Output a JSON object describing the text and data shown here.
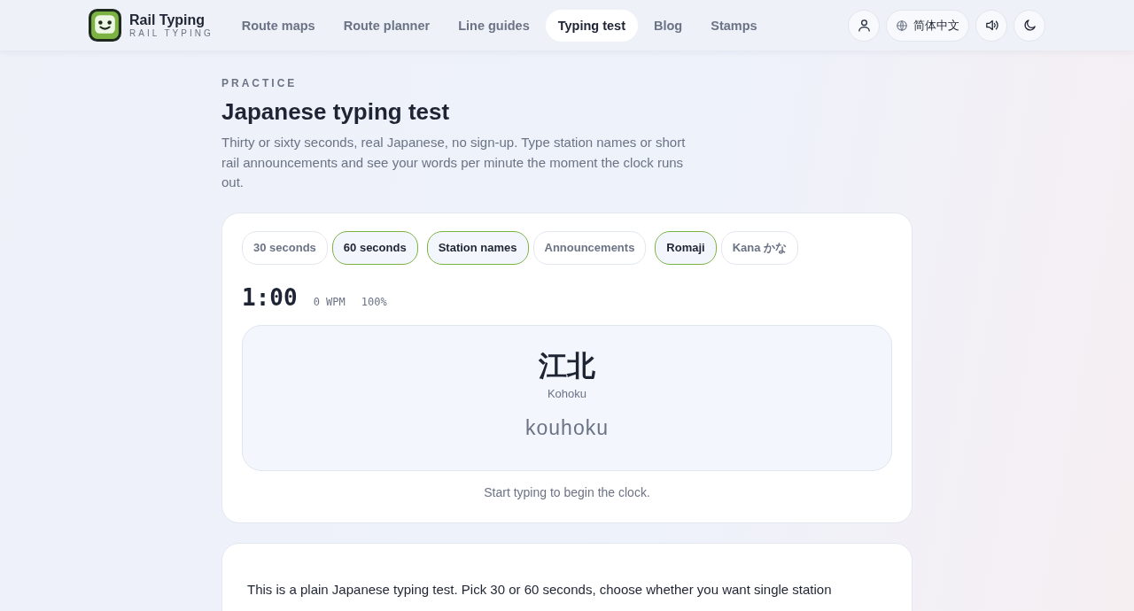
{
  "header": {
    "brand": {
      "name": "Rail Typing",
      "subtitle": "RAIL TYPING"
    },
    "nav": [
      {
        "label": "Route maps",
        "selected": false
      },
      {
        "label": "Route planner",
        "selected": false
      },
      {
        "label": "Line guides",
        "selected": false
      },
      {
        "label": "Typing test",
        "selected": true
      },
      {
        "label": "Blog",
        "selected": false
      },
      {
        "label": "Stamps",
        "selected": false
      }
    ],
    "actions": [
      {
        "kind": "account"
      },
      {
        "kind": "language",
        "label": "简体中文"
      },
      {
        "kind": "sound"
      },
      {
        "kind": "theme"
      }
    ]
  },
  "intro": {
    "eyebrow": "PRACTICE",
    "title": "Japanese typing test",
    "description": "Thirty or sixty seconds, real Japanese, no sign-up. Type station names or short rail announcements and see your words per minute the moment the clock runs out."
  },
  "test": {
    "options": [
      {
        "label": "30 seconds",
        "selected": false
      },
      {
        "label": "60 seconds",
        "selected": true
      },
      {
        "label": "Station names",
        "selected": true
      },
      {
        "label": "Announcements",
        "selected": false
      },
      {
        "label": "Romaji",
        "selected": true
      },
      {
        "label": "Kana かな",
        "selected": false
      }
    ],
    "timer": "1:00",
    "wpm": "0 WPM",
    "accuracy": "100%",
    "prompt": {
      "kanji": "江北",
      "reading": "Kohoku",
      "romaji": "kouhoku"
    },
    "hint": "Start typing to begin the clock."
  },
  "article": {
    "paragraph": "This is a plain Japanese typing test. Pick 30 or 60 seconds, choose whether you want single station"
  }
}
